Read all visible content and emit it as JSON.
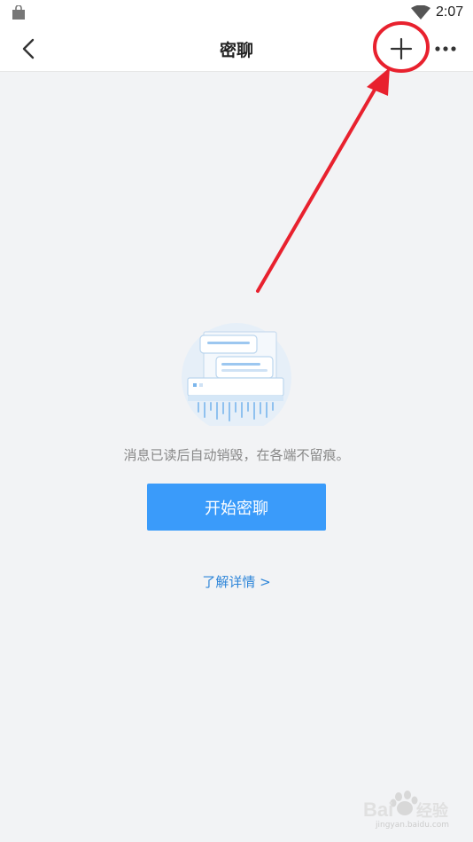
{
  "status_bar": {
    "time": "2:07"
  },
  "header": {
    "title": "密聊"
  },
  "empty_state": {
    "description": "消息已读后自动销毁，在各端不留痕。",
    "start_button_label": "开始密聊",
    "learn_more_label": "了解详情 >"
  },
  "annotation": {
    "color": "#e8212e"
  },
  "watermark": {
    "text": "jingyan.baidu.com",
    "brand": "Baidu经验"
  },
  "colors": {
    "accent": "#3a9bfa",
    "link": "#2f86d9",
    "background": "#f2f3f5"
  },
  "icons": [
    "bag-icon",
    "wifi-icon",
    "back-icon",
    "plus-icon",
    "more-icon"
  ]
}
